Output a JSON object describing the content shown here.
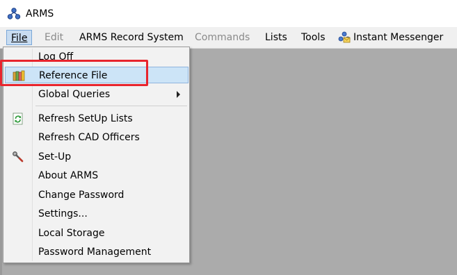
{
  "window": {
    "title": "ARMS",
    "icon": "arms-network-icon"
  },
  "menubar": {
    "items": [
      {
        "label": "File",
        "state": "open"
      },
      {
        "label": "Edit",
        "state": "disabled"
      },
      {
        "label": "ARMS Record System",
        "state": "enabled"
      },
      {
        "label": "Commands",
        "state": "disabled"
      },
      {
        "label": "Lists",
        "state": "enabled"
      },
      {
        "label": "Tools",
        "state": "enabled"
      },
      {
        "label": "Instant Messenger",
        "state": "enabled",
        "icon": "messenger-icon"
      }
    ]
  },
  "file_menu": {
    "items": [
      {
        "label": "Log Off"
      },
      {
        "label": "Reference File",
        "icon": "books-icon",
        "highlighted": true
      },
      {
        "label": "Global Queries",
        "submenu": true
      },
      {
        "label": "Refresh SetUp Lists",
        "icon": "refresh-icon"
      },
      {
        "label": "Refresh CAD Officers"
      },
      {
        "label": "Set-Up",
        "icon": "wrench-icon"
      },
      {
        "label": "About ARMS"
      },
      {
        "label": "Change Password"
      },
      {
        "label": "Settings..."
      },
      {
        "label": "Local Storage"
      },
      {
        "label": "Password Management"
      }
    ]
  },
  "colors": {
    "highlight_box": "#e8242d",
    "menu_highlight": "#cce4f7",
    "workspace": "#ababab"
  }
}
